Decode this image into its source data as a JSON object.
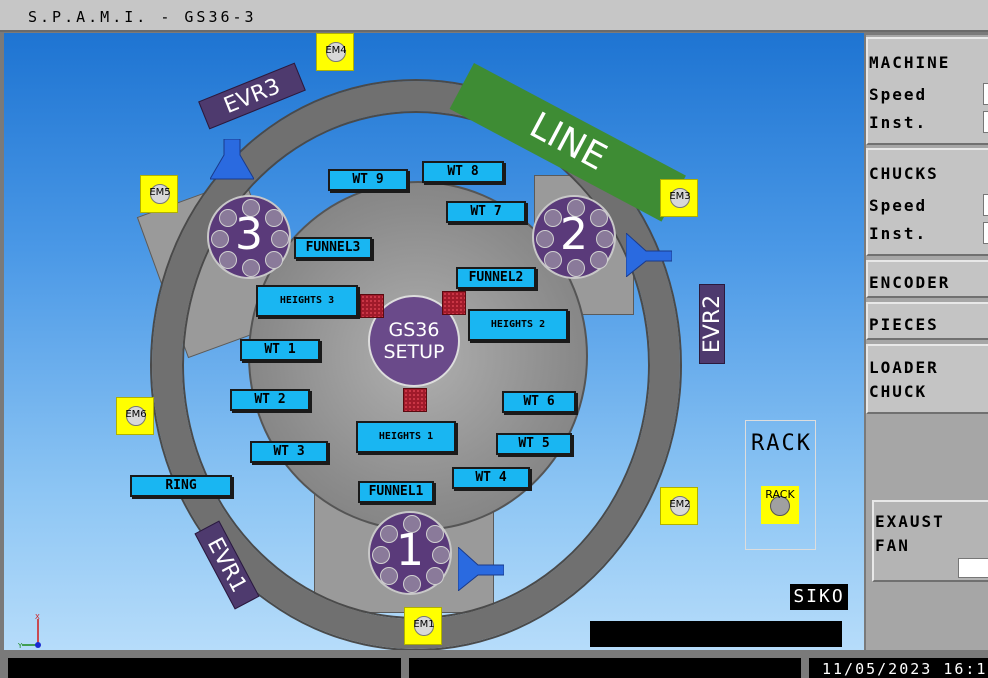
{
  "title": "S.P.A.M.I. - GS36-3",
  "diagram": {
    "line_banner": "LINE",
    "evr": [
      "EVR1",
      "EVR2",
      "EVR3"
    ],
    "em": [
      "EM1",
      "EM2",
      "EM3",
      "EM4",
      "EM5",
      "EM6"
    ],
    "stations": [
      "1",
      "2",
      "3"
    ],
    "center": {
      "line1": "GS36",
      "line2": "SETUP"
    },
    "labels": {
      "wt1": "WT 1",
      "wt2": "WT 2",
      "wt3": "WT 3",
      "wt4": "WT 4",
      "wt5": "WT 5",
      "wt6": "WT 6",
      "wt7": "WT 7",
      "wt8": "WT 8",
      "wt9": "WT 9",
      "funnel1": "FUNNEL1",
      "funnel2": "FUNNEL2",
      "funnel3": "FUNNEL3",
      "heights1": "HEIGHTS 1",
      "heights2": "HEIGHTS 2",
      "heights3": "HEIGHTS 3",
      "ring": "RING"
    },
    "rack": {
      "title": "RACK",
      "indicator": "RACK"
    },
    "siko": "SIKO",
    "axis": {
      "x": "X",
      "y": "Y"
    }
  },
  "panel": {
    "machine": {
      "title": "MACHINE",
      "speed": "Speed",
      "inst": "Inst."
    },
    "chucks": {
      "title": "CHUCKS",
      "speed": "Speed",
      "inst": "Inst."
    },
    "encoder": "ENCODER",
    "pieces": "PIECES",
    "loader": {
      "line1": "LOADER",
      "line2": "CHUCK"
    },
    "exhaust": {
      "line1": "EXAUST",
      "line2": "FAN"
    }
  },
  "status_bar": {
    "datetime": "11/05/2023  16:1"
  },
  "colors": {
    "label_bg": "#19b6f2",
    "em_bg": "#ffff00",
    "station": "#5a3a7a",
    "line": "#3e8c34",
    "evr": "#4e3a6e"
  }
}
